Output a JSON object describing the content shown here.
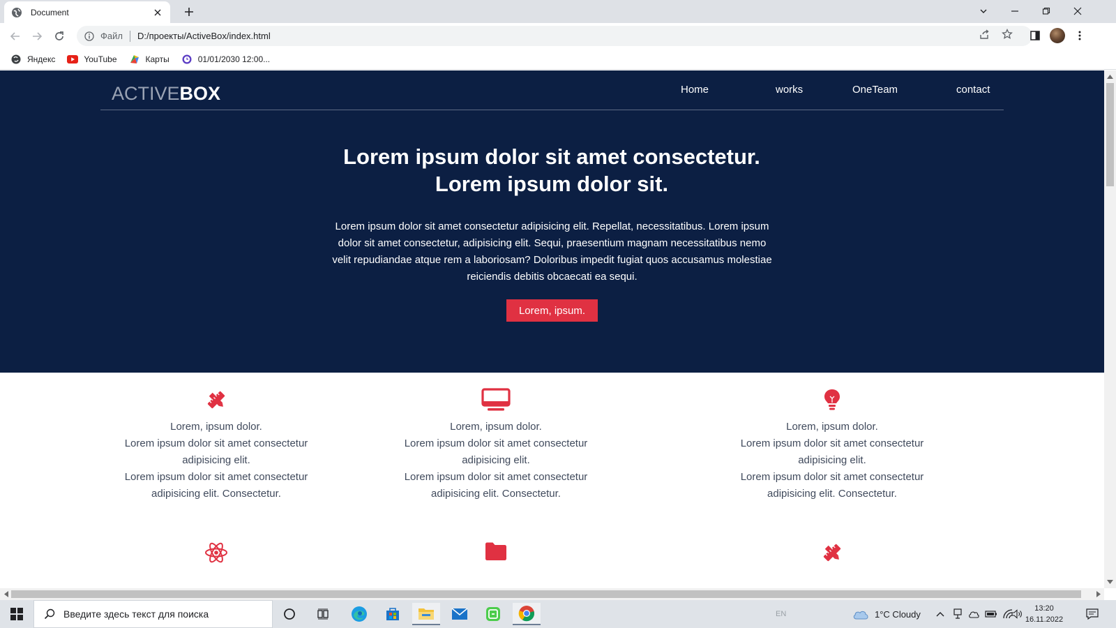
{
  "browser": {
    "tab_title": "Document",
    "url_scheme_label": "Файл",
    "url": "D:/проекты/ActiveBox/index.html",
    "bookmarks": [
      {
        "label": "Яндекс",
        "icon": "yandex-icon"
      },
      {
        "label": "YouTube",
        "icon": "youtube-icon"
      },
      {
        "label": "Карты",
        "icon": "maps-icon"
      },
      {
        "label": "01/01/2030 12:00...",
        "icon": "clock-site-icon"
      }
    ]
  },
  "site": {
    "logo_light": "ACTIVE",
    "logo_bold": "BOX",
    "nav": [
      "Home",
      "works",
      "OneTeam",
      "contact"
    ],
    "hero_title_line1": "Lorem ipsum dolor sit amet consectetur.",
    "hero_title_line2": "Lorem ipsum dolor sit.",
    "hero_text": "Lorem ipsum dolor sit amet consectetur adipisicing elit. Repellat, necessitatibus. Lorem ipsum dolor sit amet consectetur, adipisicing elit. Sequi, praesentium magnam necessitatibus nemo velit repudiandae atque rem a laboriosam? Doloribus impedit fugiat quos accusamus molestiae reiciendis debitis obcaecati ea sequi.",
    "hero_button": "Lorem, ipsum.",
    "accent_color": "#e03142",
    "hero_bg_color": "#0c1f43",
    "features": [
      {
        "icon": "pencil-ruler-icon",
        "title": "Lorem, ipsum dolor.",
        "line1": "Lorem ipsum dolor sit amet consectetur adipisicing elit.",
        "line2": "Lorem ipsum dolor sit amet consectetur adipisicing elit. Consectetur."
      },
      {
        "icon": "desktop-icon",
        "title": "Lorem, ipsum dolor.",
        "line1": "Lorem ipsum dolor sit amet consectetur adipisicing elit.",
        "line2": "Lorem ipsum dolor sit amet consectetur adipisicing elit. Consectetur."
      },
      {
        "icon": "lightbulb-icon",
        "title": "Lorem, ipsum dolor.",
        "line1": "Lorem ipsum dolor sit amet consectetur adipisicing elit.",
        "line2": "Lorem ipsum dolor sit amet consectetur adipisicing elit. Consectetur."
      }
    ],
    "features_row2_icons": [
      "atom-icon",
      "folder-icon",
      "pencil-ruler-icon"
    ]
  },
  "taskbar": {
    "search_placeholder": "Введите здесь текст для поиска",
    "lang": "EN",
    "weather": "1°C  Cloudy",
    "time": "13:20",
    "date": "16.11.2022"
  }
}
